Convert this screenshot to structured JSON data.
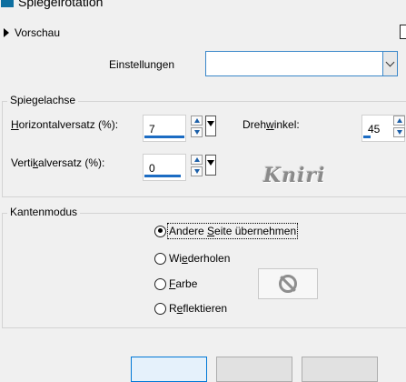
{
  "window": {
    "title": "Spiegelrotation"
  },
  "preview": {
    "label": "Vorschau"
  },
  "settings": {
    "label": "Einstellungen",
    "value": ""
  },
  "mirror_axis": {
    "title": "Spiegelachse",
    "horizontal_offset": {
      "label_pre": "",
      "label_mnemonic": "H",
      "label_post": "orizontalversatz (%):",
      "value": "7",
      "level": 0.55
    },
    "vertical_offset": {
      "label_pre": "Verti",
      "label_mnemonic": "k",
      "label_post": "alversatz (%):",
      "value": "0",
      "level": 0.5
    },
    "rotation_angle": {
      "label_pre": "Dreh",
      "label_mnemonic": "w",
      "label_post": "inkel:",
      "value": "45",
      "level": 0.125
    }
  },
  "watermark": "Kniri",
  "edge_mode": {
    "title": "Kantenmodus",
    "options": [
      {
        "pre": "Andere ",
        "mnemonic": "S",
        "post": "eite übernehmen",
        "checked": true
      },
      {
        "pre": "Wi",
        "mnemonic": "e",
        "post": "derholen",
        "checked": false
      },
      {
        "pre": "",
        "mnemonic": "F",
        "post": "arbe",
        "checked": false
      },
      {
        "pre": "R",
        "mnemonic": "e",
        "post": "flektieren",
        "checked": false
      }
    ]
  },
  "colors": {
    "accent": "#1c6cc3",
    "swatch_icon": "prohibit-icon"
  }
}
